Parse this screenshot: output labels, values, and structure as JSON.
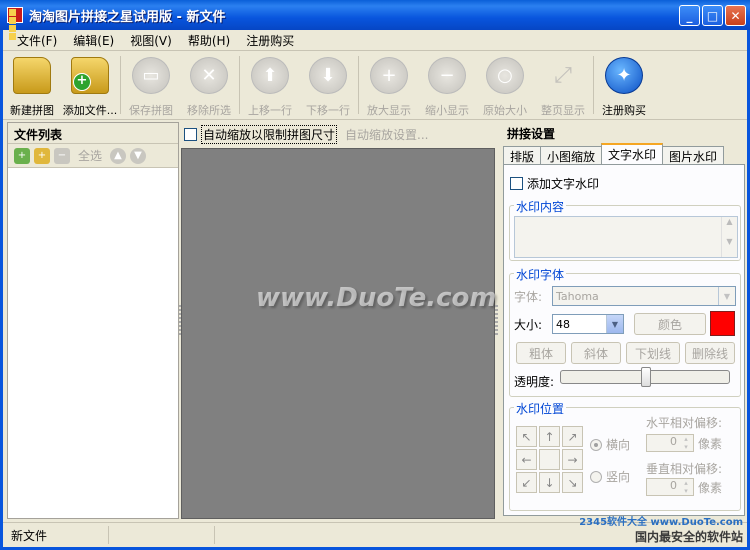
{
  "window": {
    "title": "淘淘图片拼接之星试用版 - 新文件",
    "controls": [
      "_",
      "□",
      "✕"
    ]
  },
  "menu": [
    "文件(F)",
    "编辑(E)",
    "视图(V)",
    "帮助(H)",
    "注册购买"
  ],
  "toolbar": [
    {
      "label": "新建拼图",
      "icon": "new-puzzle-icon",
      "enabled": true
    },
    {
      "label": "添加文件...",
      "icon": "add-file-icon",
      "enabled": true
    },
    {
      "label": "保存拼图",
      "icon": "save-icon",
      "enabled": false
    },
    {
      "label": "移除所选",
      "icon": "remove-icon",
      "enabled": false
    },
    {
      "label": "上移一行",
      "icon": "arrow-up-icon",
      "enabled": false
    },
    {
      "label": "下移一行",
      "icon": "arrow-down-icon",
      "enabled": false
    },
    {
      "label": "放大显示",
      "icon": "zoom-in-icon",
      "enabled": false
    },
    {
      "label": "缩小显示",
      "icon": "zoom-out-icon",
      "enabled": false
    },
    {
      "label": "原始大小",
      "icon": "actual-size-icon",
      "enabled": false
    },
    {
      "label": "整页显示",
      "icon": "fit-page-icon",
      "enabled": false
    },
    {
      "label": "注册购买",
      "icon": "register-buy-icon",
      "enabled": true
    }
  ],
  "file_list": {
    "title": "文件列表",
    "select_all": "全选"
  },
  "center": {
    "auto_scale_label": "自动缩放以限制拼图尺寸",
    "auto_scale_settings": "自动缩放设置...",
    "watermark": "www.DuoTe.com"
  },
  "settings": {
    "title": "拼接设置",
    "tabs": [
      "排版",
      "小图缩放",
      "文字水印",
      "图片水印"
    ],
    "active_tab": "文字水印",
    "add_text_watermark": "添加文字水印",
    "content_group": "水印内容",
    "font_group": "水印字体",
    "font_label": "字体:",
    "font_value": "Tahoma",
    "size_label": "大小:",
    "size_value": "48",
    "color_button": "颜色",
    "color_value": "#ff0000",
    "bold": "粗体",
    "italic": "斜体",
    "underline": "下划线",
    "strike": "删除线",
    "opacity_label": "透明度:",
    "opacity_value": 0.5,
    "position_group": "水印位置",
    "horizontal": "横向",
    "vertical": "竖向",
    "h_offset_label": "水平相对偏移:",
    "v_offset_label": "垂直相对偏移:",
    "h_offset_value": "0",
    "v_offset_value": "0",
    "unit": "像素"
  },
  "status": {
    "file": "新文件",
    "brand_top": "2345软件大全",
    "brand_url": "www.DuoTe.com",
    "brand_bottom": "国内最安全的软件站"
  }
}
